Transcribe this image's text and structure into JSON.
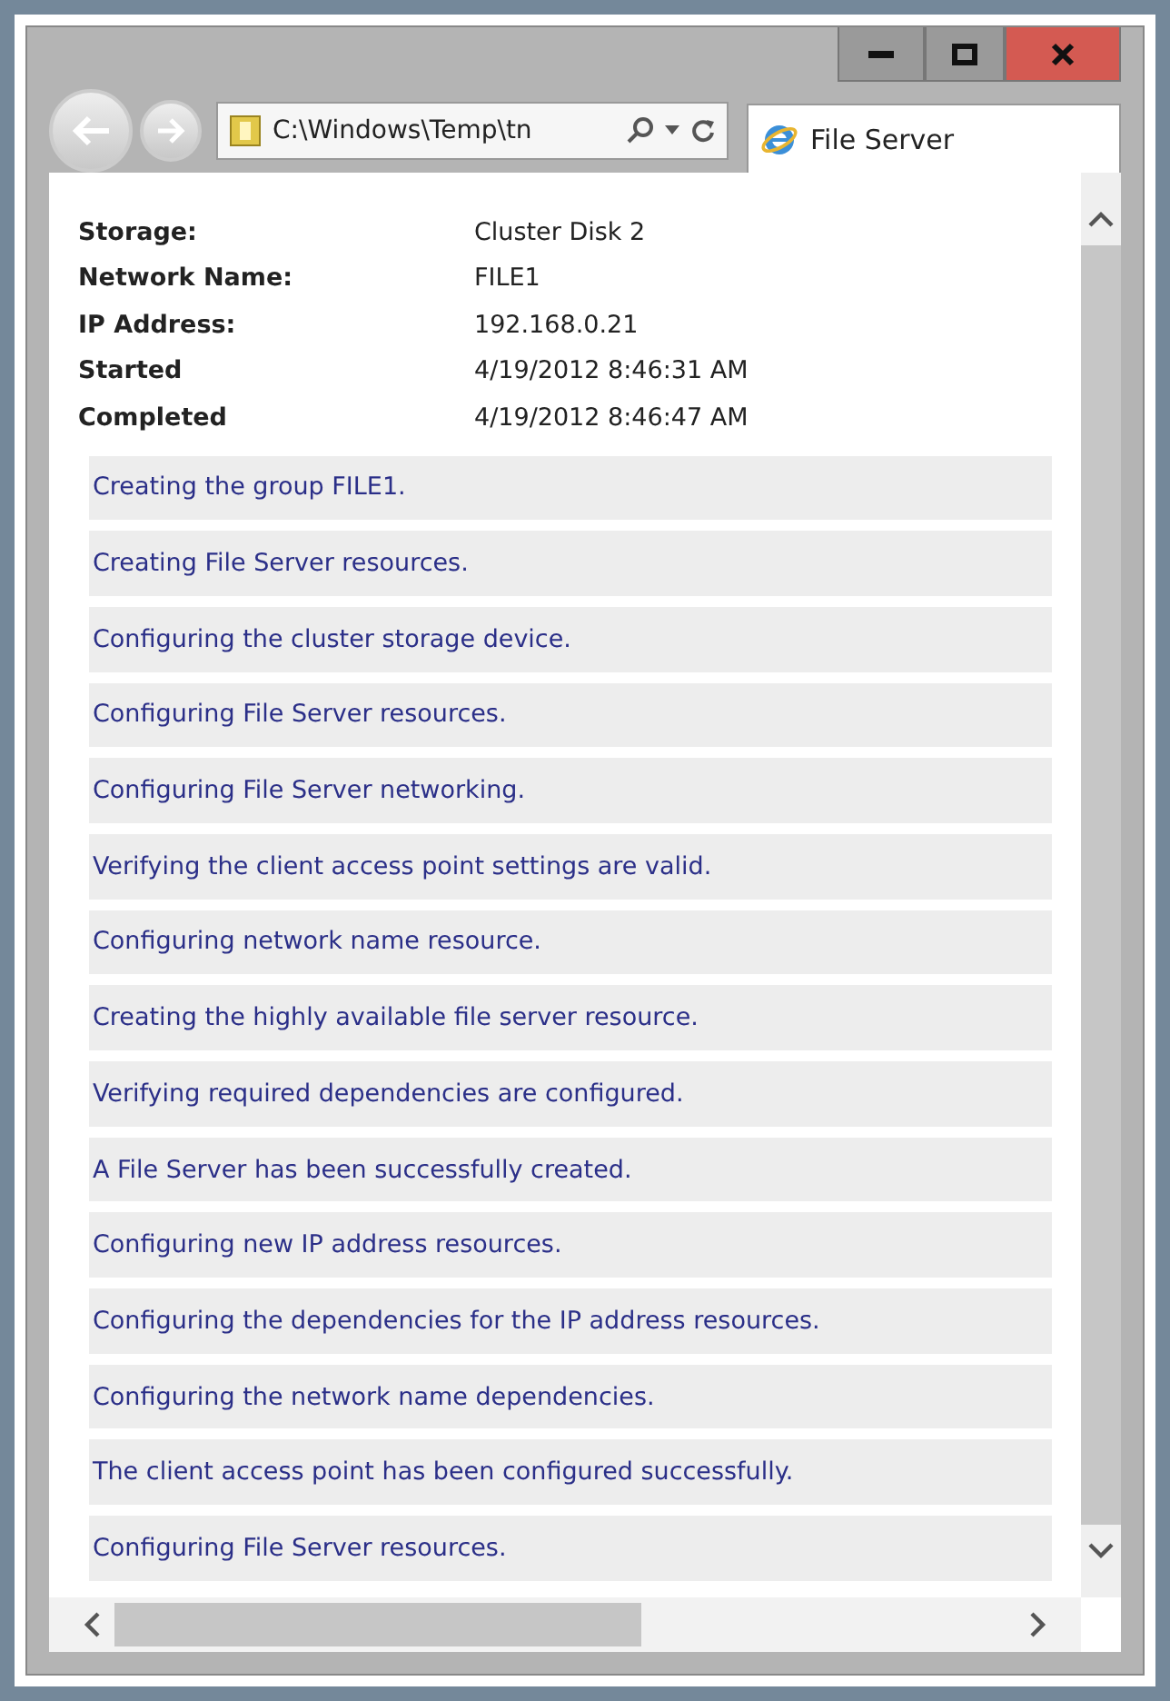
{
  "address_bar": {
    "value": "C:\\Windows\\Temp\\tn"
  },
  "tab": {
    "label": "File Server",
    "selected": true
  },
  "details": [
    {
      "label": "Storage:",
      "value": "Cluster Disk 2"
    },
    {
      "label": "Network Name:",
      "value": "FILE1"
    },
    {
      "label": "IP Address:",
      "value": "192.168.0.21"
    },
    {
      "label": "Started",
      "value": "4/19/2012 8:46:31 AM"
    },
    {
      "label": "Completed",
      "value": "4/19/2012 8:46:47 AM"
    }
  ],
  "log": [
    "Creating the group FILE1.",
    "Creating File Server resources.",
    "Configuring the cluster storage device.",
    "Configuring File Server resources.",
    "Configuring File Server networking.",
    "Verifying the client access point settings are valid.",
    "Configuring network name resource.",
    "Creating the highly available file server resource.",
    "Verifying required dependencies are configured.",
    "A File Server has been successfully created.",
    "Configuring new IP address resources.",
    "Configuring the dependencies for the IP address resources.",
    "Configuring the network name dependencies.",
    "The client access point has been configured successfully.",
    "Configuring File Server resources."
  ]
}
